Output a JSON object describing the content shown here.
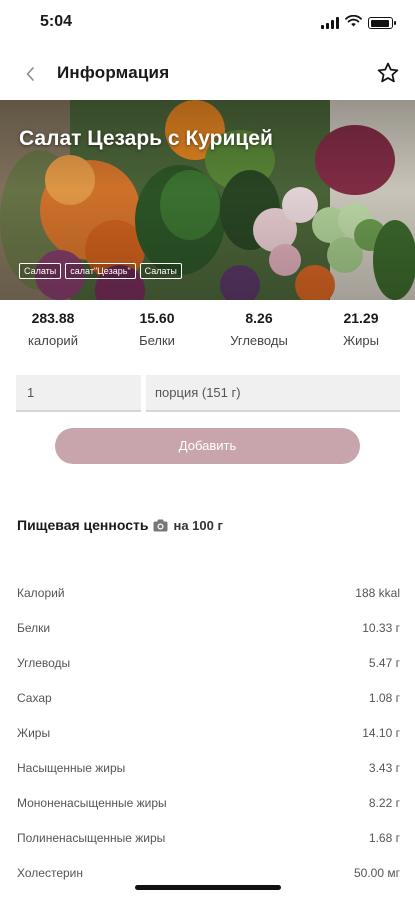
{
  "status_bar": {
    "time": "5:04",
    "battery_level": 0.9
  },
  "nav": {
    "title": "Информация",
    "back_icon": "chevron-left-icon",
    "favorite_icon": "star-outline-icon"
  },
  "hero": {
    "title": "Салат Цезарь с Курицей",
    "tags": [
      "Салаты",
      "салат\"Цезарь\"",
      "Салаты"
    ]
  },
  "macros": [
    {
      "value": "283.88",
      "label": "калорий"
    },
    {
      "value": "15.60",
      "label": "Белки"
    },
    {
      "value": "8.26",
      "label": "Углеводы"
    },
    {
      "value": "21.29",
      "label": "Жиры"
    }
  ],
  "serving": {
    "quantity": "1",
    "portion": "порция (151 г)"
  },
  "add_button": {
    "label": "Добавить",
    "color": "#c8a5ad"
  },
  "nutrition": {
    "title": "Пищевая ценность",
    "per": "на 100 г",
    "per_icon": "camera-icon",
    "rows": [
      {
        "name": "Калорий",
        "value": "188 kkal"
      },
      {
        "name": "Белки",
        "value": "10.33 г"
      },
      {
        "name": "Углеводы",
        "value": "5.47 г"
      },
      {
        "name": "Сахар",
        "value": "1.08 г"
      },
      {
        "name": "Жиры",
        "value": "14.10 г"
      },
      {
        "name": "Насыщенные жиры",
        "value": "3.43 г"
      },
      {
        "name": "Мононенасыщенные жиры",
        "value": "8.22 г"
      },
      {
        "name": "Полиненасыщенные жиры",
        "value": "1.68 г"
      },
      {
        "name": "Холестерин",
        "value": "50.00 мг"
      }
    ]
  }
}
